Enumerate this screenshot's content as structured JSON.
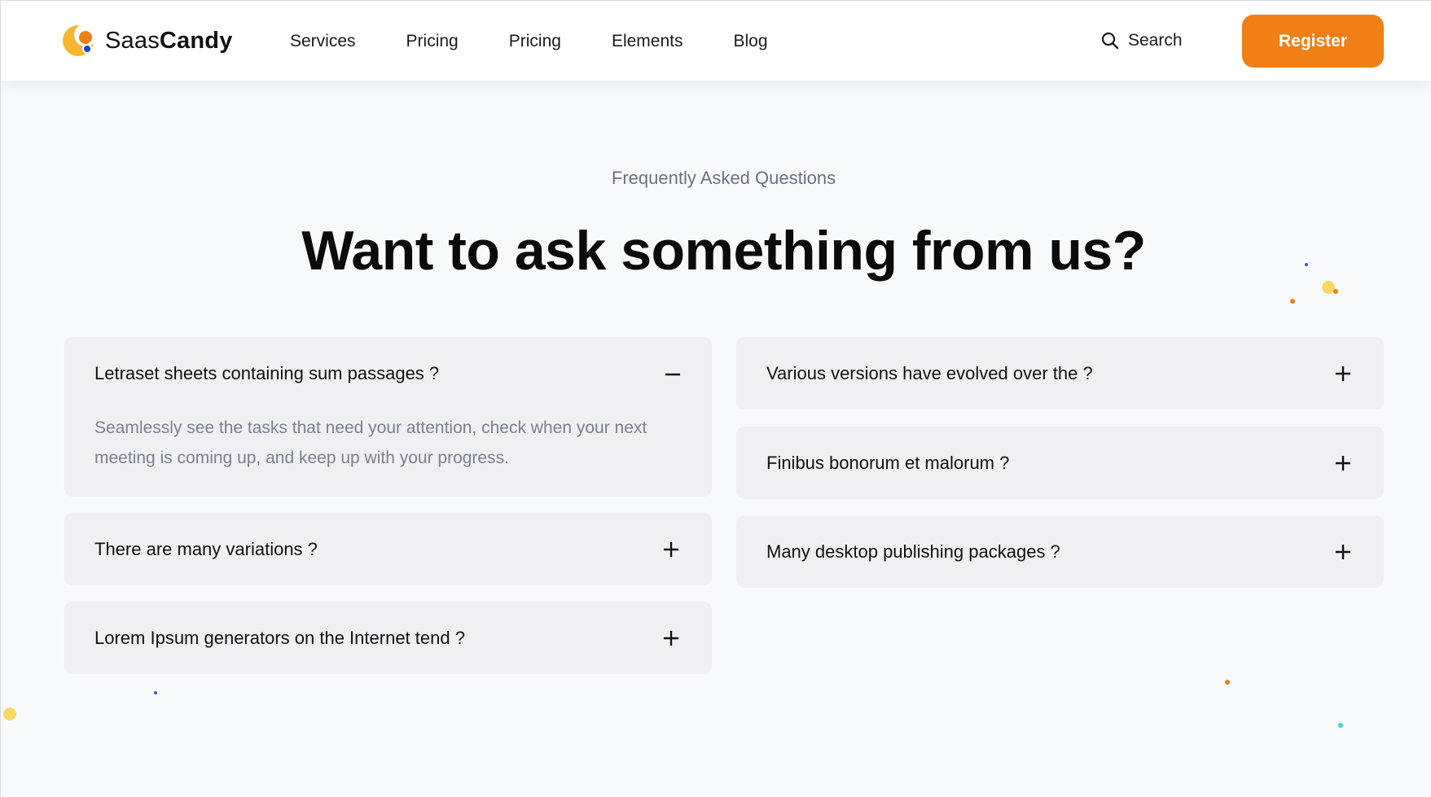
{
  "brand": {
    "name_light": "Saas",
    "name_bold": "Candy",
    "colors": {
      "accent": "#f07f16",
      "sun": "#f7b531",
      "dot": "#1e3fd0"
    }
  },
  "nav": {
    "items": [
      {
        "label": "Services"
      },
      {
        "label": "Pricing"
      },
      {
        "label": "Pricing"
      },
      {
        "label": "Elements"
      },
      {
        "label": "Blog"
      }
    ]
  },
  "search": {
    "label": "Search",
    "icon": "search-icon"
  },
  "register": {
    "label": "Register"
  },
  "hero": {
    "eyebrow": "Frequently Asked Questions",
    "title": "Want to ask something from us?"
  },
  "faq": {
    "left": [
      {
        "question": "Letraset sheets containing sum passages ?",
        "expanded": true,
        "answer": "Seamlessly see the tasks that need your attention, check when your next meeting is coming up, and keep up with your progress.",
        "toggle_icon": "minus-icon"
      },
      {
        "question": "There are many variations ?",
        "expanded": false,
        "toggle_icon": "plus-icon"
      },
      {
        "question": "Lorem Ipsum generators on the Internet tend ?",
        "expanded": false,
        "toggle_icon": "plus-icon"
      }
    ],
    "right": [
      {
        "question": "Various versions have evolved over the ?",
        "expanded": false,
        "toggle_icon": "plus-icon"
      },
      {
        "question": "Finibus bonorum et malorum ?",
        "expanded": false,
        "toggle_icon": "plus-icon"
      },
      {
        "question": "Many desktop publishing packages ?",
        "expanded": false,
        "toggle_icon": "plus-icon"
      }
    ]
  }
}
